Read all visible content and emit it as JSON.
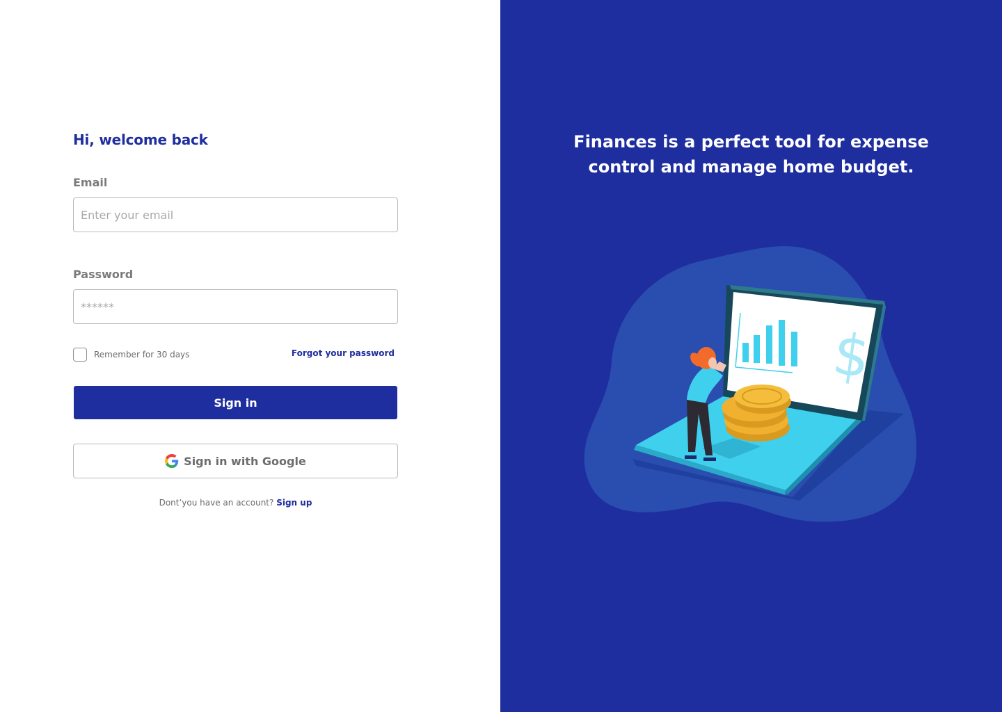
{
  "login": {
    "welcome": "Hi, welcome back",
    "email_label": "Email",
    "email_placeholder": "Enter your email",
    "password_label": "Password",
    "password_placeholder": "******",
    "remember_label": "Remember for 30 days",
    "forgot_label": "Forgot your password",
    "signin_label": "Sign in",
    "google_label": "Sign in with Google",
    "signup_prompt": "Dont’you have an account?",
    "signup_label": "Sign up"
  },
  "promo": {
    "headline_line1": "Finances is a perfect tool for expense",
    "headline_line2": "control and manage home budget."
  },
  "colors": {
    "brand": "#1f2e9e",
    "panel_bg": "#1f2e9e",
    "blob": "#2a4db0",
    "laptop_cyan": "#3fd0ee",
    "coin": "#f0b030",
    "person_hair": "#f26b2a"
  },
  "icons": {
    "google": "google-g-icon",
    "illustration": "finance-laptop-illustration"
  }
}
